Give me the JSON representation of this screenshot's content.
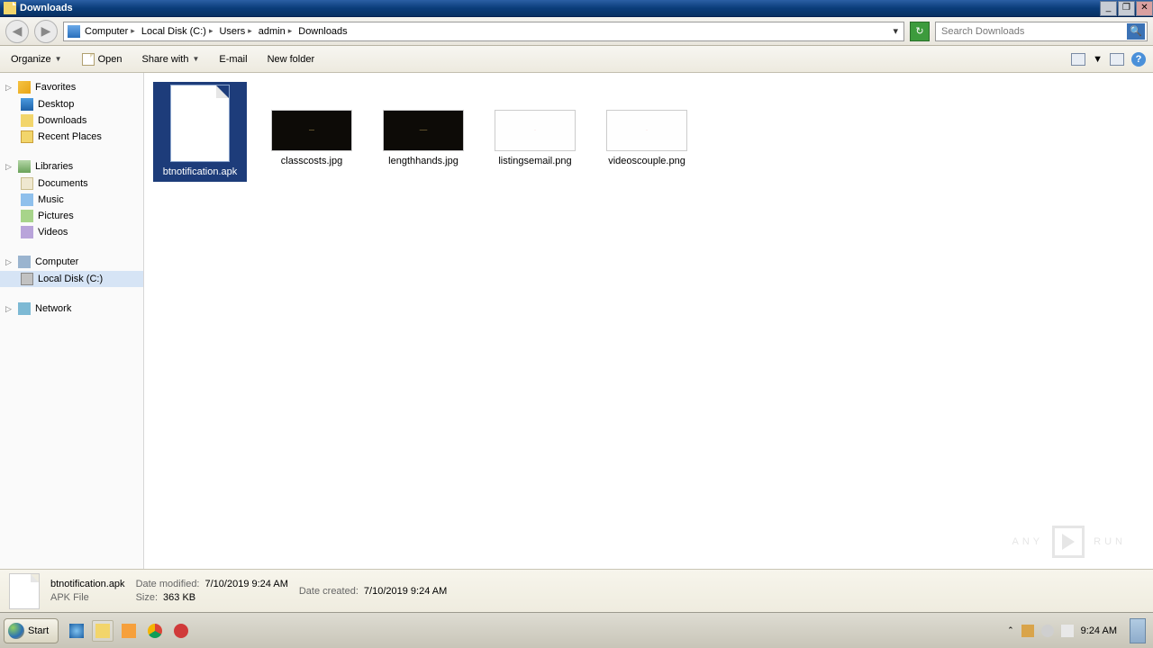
{
  "window": {
    "title": "Downloads"
  },
  "breadcrumbs": [
    "Computer",
    "Local Disk (C:)",
    "Users",
    "admin",
    "Downloads"
  ],
  "search": {
    "placeholder": "Search Downloads"
  },
  "toolbar": {
    "organize": "Organize",
    "open": "Open",
    "share": "Share with",
    "email": "E-mail",
    "newfolder": "New folder"
  },
  "sidebar": {
    "favorites": {
      "label": "Favorites",
      "items": [
        "Desktop",
        "Downloads",
        "Recent Places"
      ]
    },
    "libraries": {
      "label": "Libraries",
      "items": [
        "Documents",
        "Music",
        "Pictures",
        "Videos"
      ]
    },
    "computer": {
      "label": "Computer",
      "items": [
        "Local Disk (C:)"
      ]
    },
    "network": {
      "label": "Network"
    }
  },
  "files": [
    {
      "name": "btnotification.apk",
      "kind": "file",
      "selected": true
    },
    {
      "name": "classcosts.jpg",
      "kind": "img-dark"
    },
    {
      "name": "lengthhands.jpg",
      "kind": "img-dark"
    },
    {
      "name": "listingsemail.png",
      "kind": "img-light"
    },
    {
      "name": "videoscouple.png",
      "kind": "img-light"
    }
  ],
  "details": {
    "name": "btnotification.apk",
    "type": "APK File",
    "modified_label": "Date modified:",
    "modified": "7/10/2019 9:24 AM",
    "created_label": "Date created:",
    "created": "7/10/2019 9:24 AM",
    "size_label": "Size:",
    "size": "363 KB"
  },
  "taskbar": {
    "start": "Start",
    "clock": "9:24 AM"
  },
  "watermark": {
    "left": "ANY",
    "right": "RUN"
  }
}
